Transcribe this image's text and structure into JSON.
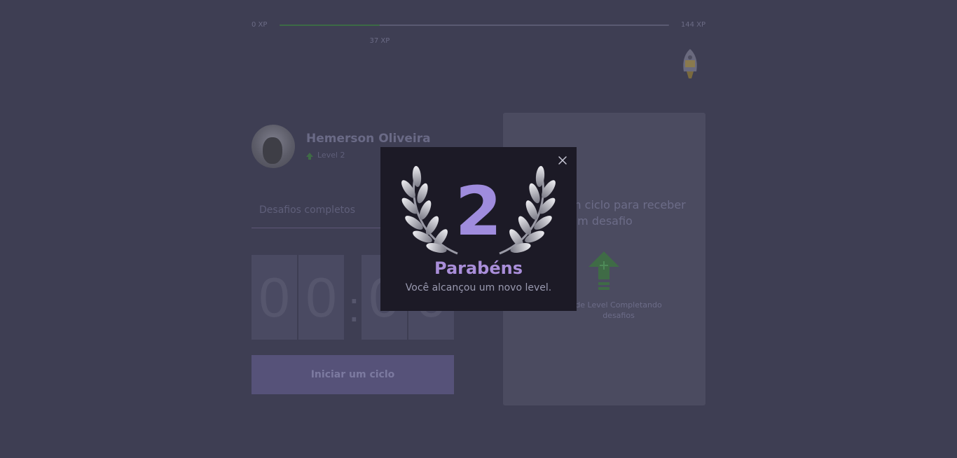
{
  "xp": {
    "min_label": "0 XP",
    "max_label": "144 XP",
    "current_label": "37 XP",
    "current_fraction": 0.257
  },
  "profile": {
    "name": "Hemerson Oliveira",
    "level_label": "Level 2"
  },
  "challenges": {
    "completed_label": "Desafios completos"
  },
  "timer": {
    "minutes": [
      "0",
      "0"
    ],
    "seconds": [
      "0",
      "0"
    ],
    "separator": ":"
  },
  "cycle_button": {
    "label": "Iniciar um ciclo"
  },
  "challenge_card": {
    "message": "m ciclo para receber um desafio",
    "hint": "de Level Completando desafios"
  },
  "modal": {
    "level_number": "2",
    "title": "Parabéns",
    "subtitle": "Você alcançou um novo level."
  },
  "colors": {
    "background": "#3e3e53",
    "modal_bg": "#1c1a26",
    "accent_purple": "#a98ed9",
    "level_green": "#3f6b46"
  },
  "icons": {
    "close": "close-icon",
    "laurel": "laurel-wreath-icon",
    "level_up": "level-up-arrow-icon",
    "badge": "rocket-badge-icon"
  }
}
